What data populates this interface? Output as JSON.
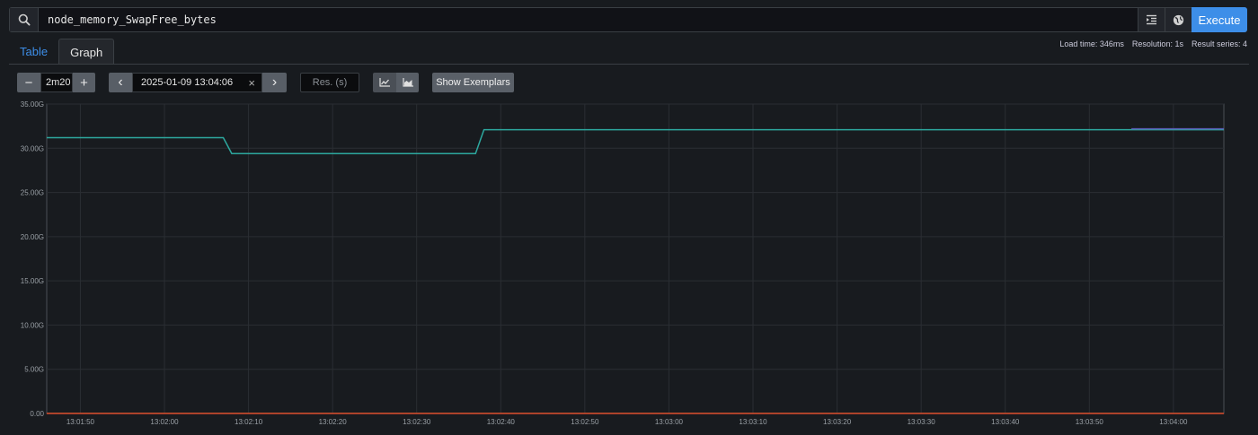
{
  "query": {
    "expression": "node_memory_SwapFree_bytes",
    "execute_label": "Execute",
    "icons": {
      "search": "search-icon",
      "format": "format-indent-icon",
      "metrics": "globe-icon"
    }
  },
  "tabs": [
    {
      "label": "Table",
      "active": false
    },
    {
      "label": "Graph",
      "active": true
    }
  ],
  "stats": {
    "load_time": "Load time: 346ms",
    "resolution": "Resolution: 1s",
    "result_series": "Result series: 4"
  },
  "controls": {
    "range_value": "2m20",
    "range_minus": "−",
    "range_plus": "+",
    "end_time": "2025-01-09 13:04:06",
    "clear": "×",
    "prev": "‹",
    "next": "›",
    "res_placeholder": "Res. (s)",
    "stacked_line_icon": "line-chart-icon",
    "stacked_area_icon": "area-chart-icon",
    "show_exemplars_label": "Show Exemplars"
  },
  "chart_data": {
    "type": "line",
    "ylim": [
      0,
      35
    ],
    "yticks": [
      0,
      5,
      10,
      15,
      20,
      25,
      30,
      35
    ],
    "ytick_labels": [
      "0.00",
      "5.00G",
      "10.00G",
      "15.00G",
      "20.00G",
      "25.00G",
      "30.00G",
      "35.00G"
    ],
    "xlim_seconds": [
      0,
      140
    ],
    "xtick_seconds": [
      4,
      14,
      24,
      34,
      44,
      54,
      64,
      74,
      84,
      94,
      104,
      114,
      124,
      134
    ],
    "xtick_labels": [
      "13:01:50",
      "13:02:00",
      "13:02:10",
      "13:02:20",
      "13:02:30",
      "13:02:40",
      "13:02:50",
      "13:03:00",
      "13:03:10",
      "13:03:20",
      "13:03:30",
      "13:03:40",
      "13:03:50",
      "13:04:00"
    ],
    "grid": true,
    "series": [
      {
        "color": "#2da89f",
        "x": [
          0,
          21,
          22,
          51,
          52,
          140
        ],
        "y": [
          31.2,
          31.2,
          29.4,
          29.4,
          32.1,
          32.1
        ]
      },
      {
        "color": "#5b5bb5",
        "x": [
          129,
          140
        ],
        "y": [
          32.2,
          32.2
        ]
      },
      {
        "color": "#c0392b",
        "x": [
          0,
          140
        ],
        "y": [
          0,
          0
        ]
      },
      {
        "color": "#d4a93b",
        "x": [
          0,
          140
        ],
        "y": [
          0.01,
          0.01
        ]
      }
    ]
  }
}
